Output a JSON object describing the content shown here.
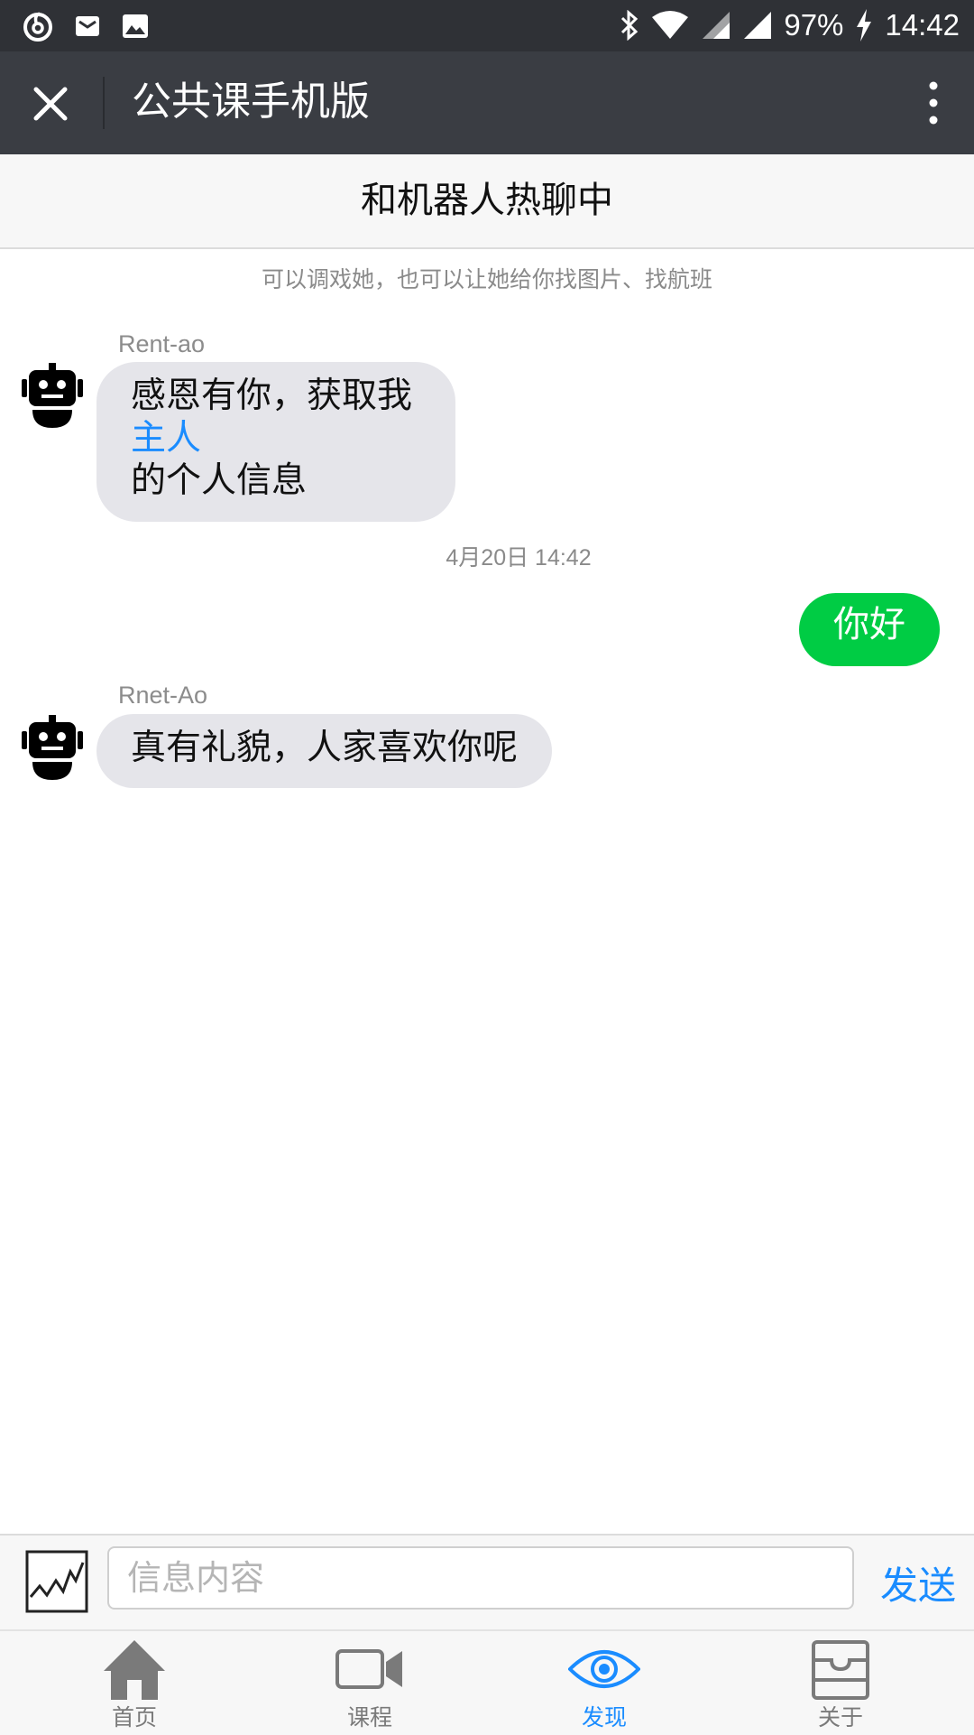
{
  "status_bar": {
    "battery": "97%",
    "time": "14:42",
    "icons": [
      "netease-music-icon",
      "mail-icon",
      "image-icon",
      "bluetooth-icon",
      "wifi-icon",
      "signal-icon",
      "charging-icon"
    ]
  },
  "title_bar": {
    "title": "公共课手机版"
  },
  "chat": {
    "header": "和机器人热聊中",
    "hint": "可以调戏她，也可以让她给你找图片、找航班",
    "messages": [
      {
        "sender": "Rent-ao",
        "line1": "感恩有你，获取我",
        "link": "主人",
        "line3": "的个人信息"
      },
      {
        "timestamp": "4月20日 14:42"
      },
      {
        "user_text": "你好"
      },
      {
        "sender": "Rnet-Ao",
        "text": "真有礼貌，人家喜欢你呢"
      }
    ]
  },
  "input_bar": {
    "placeholder": "信息内容",
    "send_label": "发送"
  },
  "tabs": [
    {
      "label": "首页",
      "icon": "home-icon",
      "active": false
    },
    {
      "label": "课程",
      "icon": "video-camera-icon",
      "active": false
    },
    {
      "label": "发现",
      "icon": "eye-icon",
      "active": true
    },
    {
      "label": "关于",
      "icon": "box-icon",
      "active": false
    }
  ],
  "colors": {
    "accent": "#1a8cff",
    "user_bubble": "#00cc44",
    "bot_bubble": "#e5e5ea",
    "title_bar": "#3a3d43",
    "status_bar": "#2f3136"
  }
}
